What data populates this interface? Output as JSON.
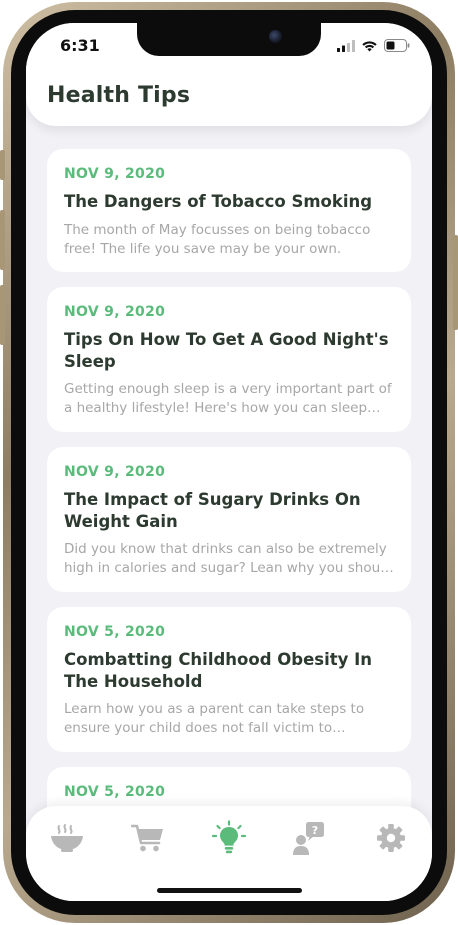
{
  "status_bar": {
    "time": "6:31"
  },
  "header": {
    "title": "Health Tips"
  },
  "articles": [
    {
      "date": "NOV 9, 2020",
      "title": "The Dangers of Tobacco Smoking",
      "summary": "The month of May focusses on being tobacco free! The life you save may be your own."
    },
    {
      "date": "NOV 9, 2020",
      "title": "Tips On How To Get A Good Night's Sleep",
      "summary": "Getting enough sleep is a very important part of a healthy lifestyle! Here's how you can sleep better."
    },
    {
      "date": "NOV 9, 2020",
      "title": "The Impact of Sugary Drinks On Weight Gain",
      "summary": "Did you know that drinks can also be extremely high in calories and sugar? Lean why you should watch out."
    },
    {
      "date": "NOV 5, 2020",
      "title": "Combatting Childhood Obesity In The Household",
      "summary": "Learn how you as a parent can take steps to ensure your child does not fall victim to childhood obesity."
    },
    {
      "date": "NOV 5, 2020",
      "title": "",
      "summary": ""
    }
  ],
  "tab_bar": {
    "tabs": [
      {
        "icon": "food-bowl-icon",
        "active": false
      },
      {
        "icon": "cart-icon",
        "active": false
      },
      {
        "icon": "lightbulb-icon",
        "active": true
      },
      {
        "icon": "consult-icon",
        "active": false
      },
      {
        "icon": "gear-icon",
        "active": false
      }
    ],
    "active_color": "#5bbb7b",
    "inactive_color": "#b8b8b8"
  },
  "colors": {
    "accent": "#5bbb7b",
    "title": "#2d3a30",
    "summary": "#a7a7a7",
    "background": "#f1f1f6"
  }
}
